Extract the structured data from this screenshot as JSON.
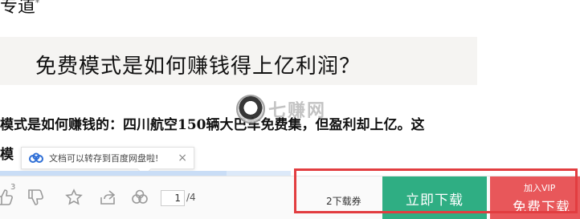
{
  "doc": {
    "top_partial": "专道",
    "top_mark": "*",
    "heading": "免费模式是如何赚钱得上亿利润？",
    "body_line1": "模式是如何赚钱的：四川航空150辆大巴车免费集，但盈利却上亿。这",
    "body_line2": "模"
  },
  "watermark": {
    "text": "七赚网"
  },
  "tooltip": {
    "text": "文档可以转存到百度网盘啦!",
    "close": "×"
  },
  "progress": {
    "fraction": 0.78
  },
  "toolbar": {
    "like_count": "3",
    "page_current": "1",
    "page_total": "/4",
    "ticket_label": "2下载券",
    "download_label": "立即下载",
    "vip_small": "加入VIP",
    "vip_label": "免费下载"
  },
  "colors": {
    "download": "#2fae83",
    "vip": "#e8575a",
    "frame": "#e23d40"
  }
}
